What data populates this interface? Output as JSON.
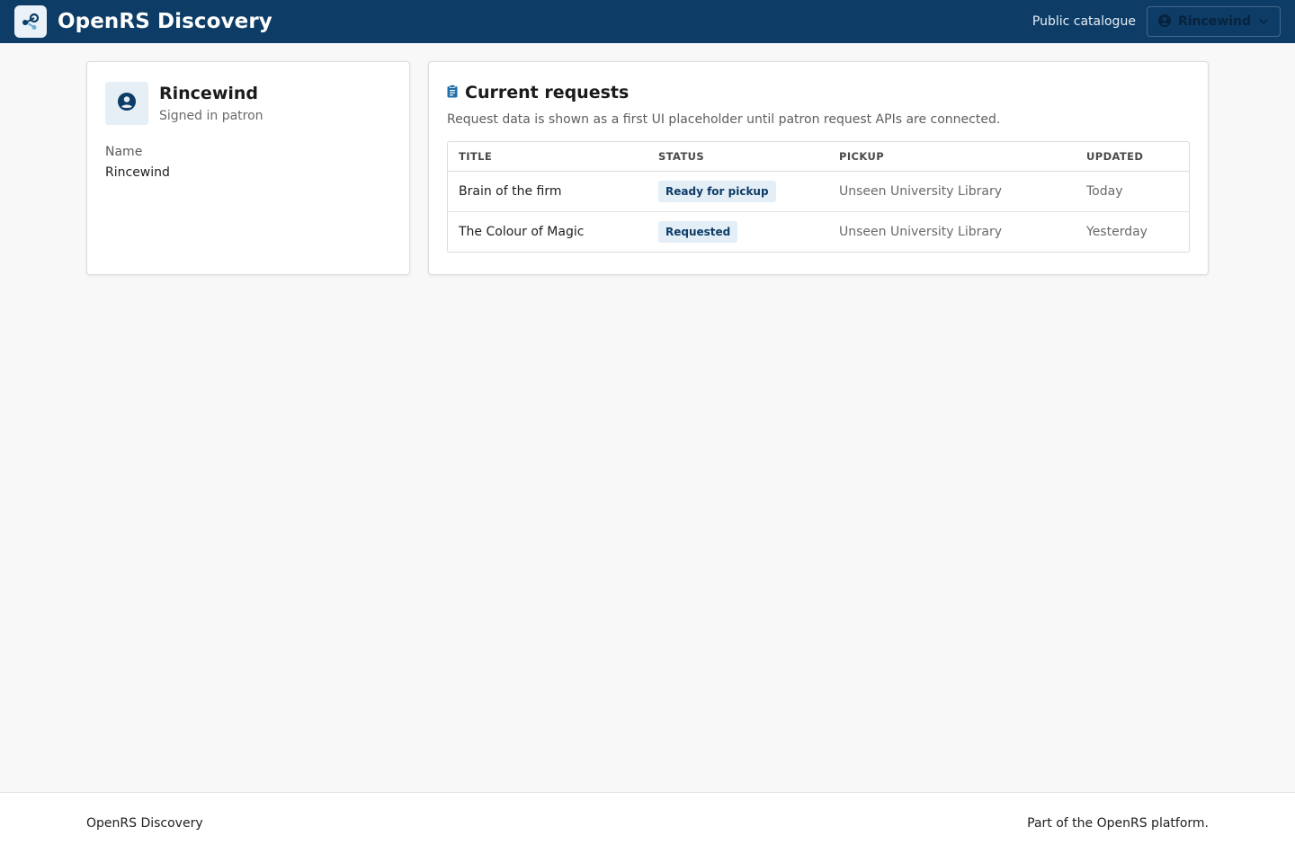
{
  "header": {
    "brand_title": "OpenRS Discovery",
    "public_catalogue_link": "Public catalogue",
    "user_menu_label": "Rincewind"
  },
  "profile": {
    "name": "Rincewind",
    "role": "Signed in patron",
    "name_field_label": "Name",
    "name_field_value": "Rincewind"
  },
  "requests": {
    "title": "Current requests",
    "description": "Request data is shown as a first UI placeholder until patron request APIs are connected.",
    "columns": [
      "TITLE",
      "STATUS",
      "PICKUP",
      "UPDATED"
    ],
    "rows": [
      {
        "title": "Brain of the firm",
        "status": "Ready for pickup",
        "pickup": "Unseen University Library",
        "updated": "Today"
      },
      {
        "title": "The Colour of Magic",
        "status": "Requested",
        "pickup": "Unseen University Library",
        "updated": "Yesterday"
      }
    ]
  },
  "footer": {
    "left": "OpenRS Discovery",
    "right": "Part of the OpenRS platform."
  },
  "colors": {
    "header_bg": "#0d3c66",
    "accent": "#1f6fa8",
    "badge_bg": "#e4eef7"
  },
  "icons": {
    "brand": "share-nodes-icon",
    "user": "user-circle-icon",
    "chevron": "chevron-down-icon",
    "requests": "clipboard-icon"
  }
}
